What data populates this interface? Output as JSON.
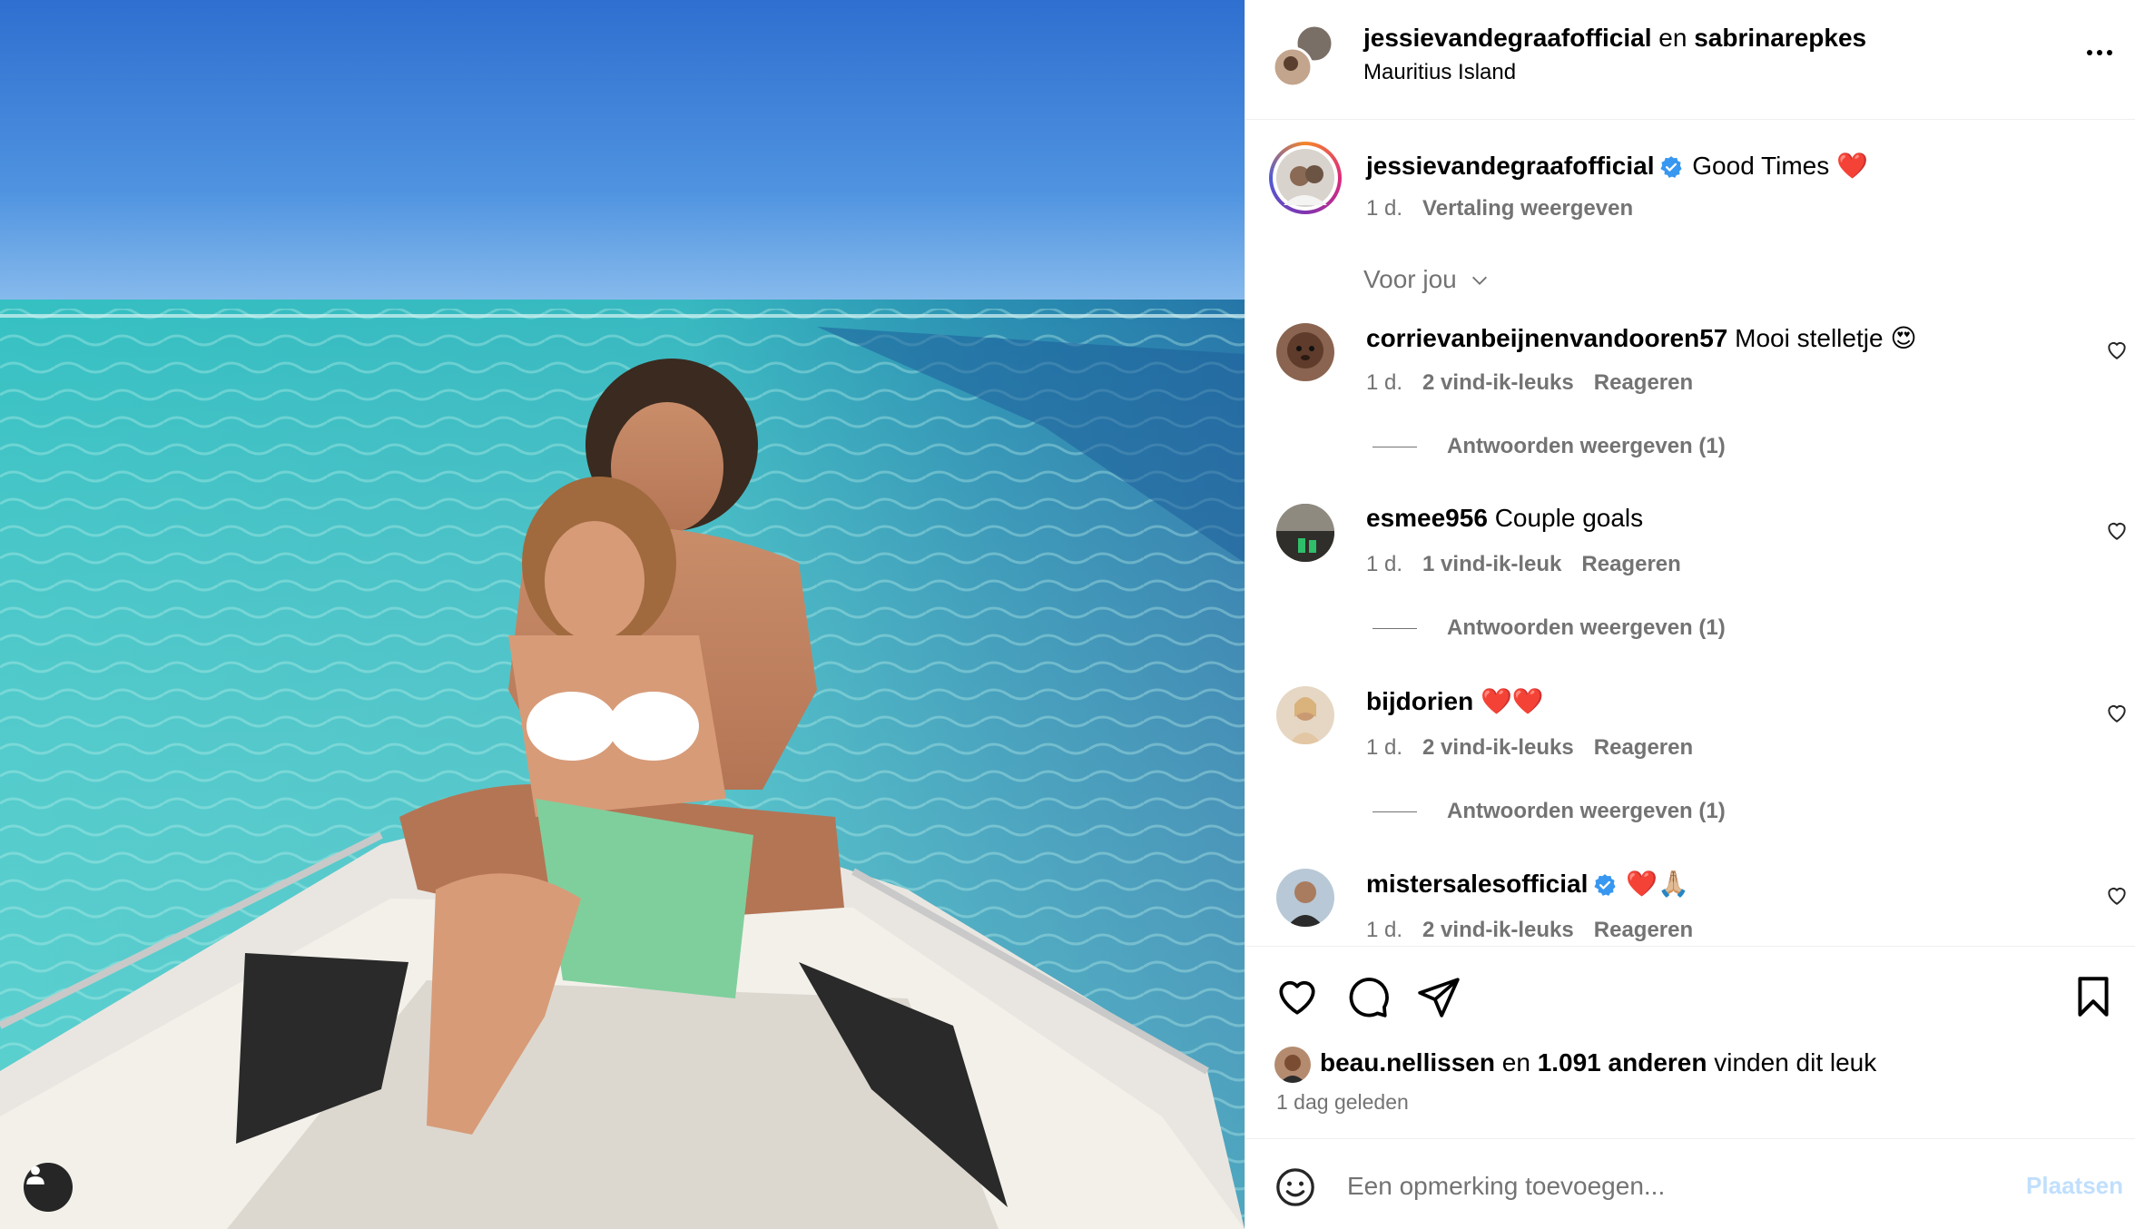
{
  "colors": {
    "accent": "#0095f6",
    "verified": "#3897f0",
    "muted_text": "#737373",
    "post_button_disabled": "#c0dffd",
    "sea_turquoise": "#2fb3b9",
    "sky_blue": "#3f86d8"
  },
  "post": {
    "image_alt": "Photo",
    "header": {
      "author": "jessievandegraafofficial",
      "connector": "en",
      "coauthor": "sabrinarepkes",
      "location": "Mauritius Island",
      "more_icon": "more-horizontal-icon"
    },
    "caption": {
      "username": "jessievandegraafofficial",
      "verified": true,
      "text": "Good Times ❤️",
      "time": "1 d.",
      "translate": "Vertaling weergeven"
    },
    "for_you_label": "Voor jou",
    "comments": [
      {
        "username": "corrievanbeijnenvandooren57",
        "verified": false,
        "text": "Mooi stelletje 😍",
        "time": "1 d.",
        "likes": "2 vind-ik-leuks",
        "reply": "Reageren",
        "view_replies": "Antwoorden weergeven (1)"
      },
      {
        "username": "esmee956",
        "verified": false,
        "text": "Couple goals",
        "time": "1 d.",
        "likes": "1 vind-ik-leuk",
        "reply": "Reageren",
        "view_replies": "Antwoorden weergeven (1)"
      },
      {
        "username": "bijdorien",
        "verified": false,
        "text": "❤️❤️",
        "time": "1 d.",
        "likes": "2 vind-ik-leuks",
        "reply": "Reageren",
        "view_replies": "Antwoorden weergeven (1)"
      },
      {
        "username": "mistersalesofficial",
        "verified": true,
        "text": "❤️🙏🏼",
        "time": "1 d.",
        "likes": "2 vind-ik-leuks",
        "reply": "Reageren"
      }
    ],
    "likes": {
      "liker": "beau.nellissen",
      "connector": "en",
      "others": "1.091 anderen",
      "suffix": "vinden dit leuk"
    },
    "posted_ago": "1 dag geleden",
    "add_comment": {
      "placeholder": "Een opmerking toevoegen...",
      "post_label": "Plaatsen"
    }
  }
}
